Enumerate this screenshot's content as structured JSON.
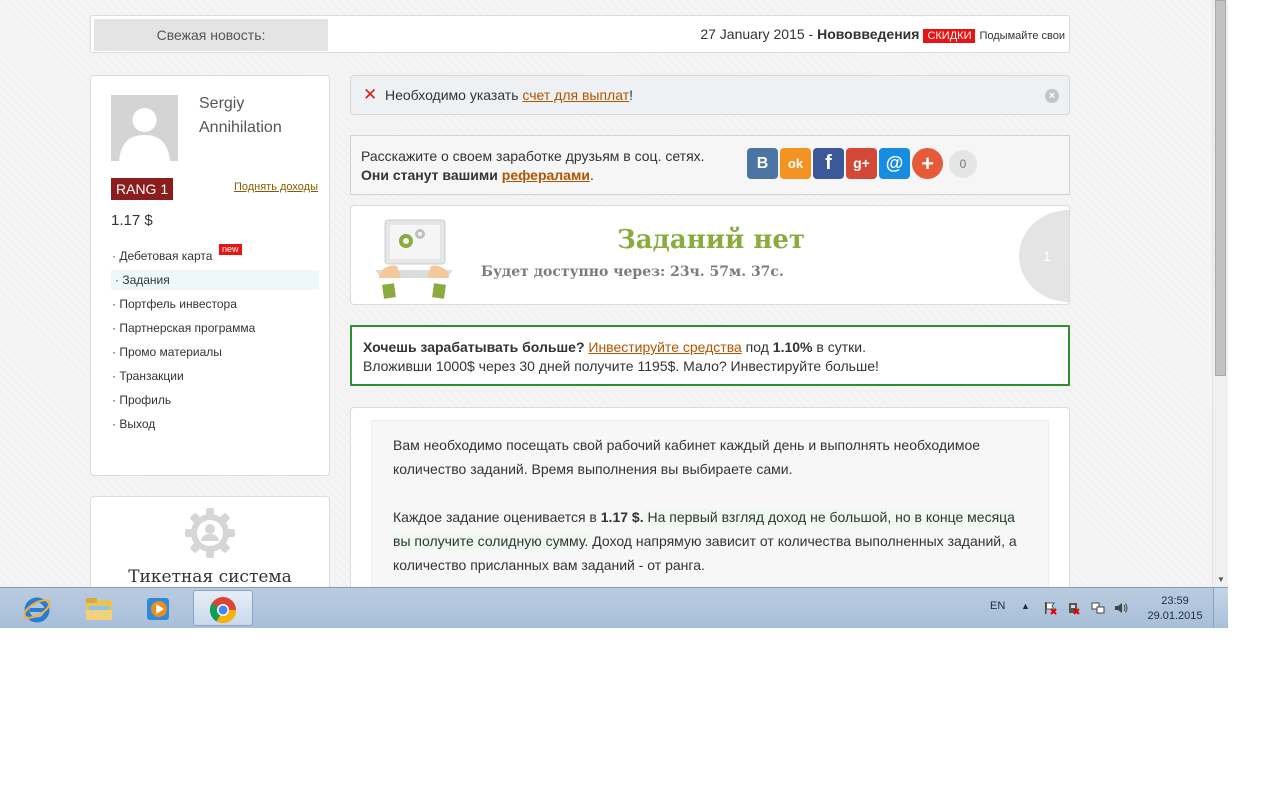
{
  "newsbar": {
    "label": "Свежая новость:",
    "date": "27 January 2015 - ",
    "title": "Нововведения",
    "badge": "СКИДКИ",
    "snippet": "Подымайте свои"
  },
  "sidebar": {
    "username_first": "Sergiy",
    "username_last": "Annihilation",
    "rank": "RANG 1",
    "raise_income": "Поднять доходы",
    "balance": "1.17 $",
    "menu": [
      {
        "label": "· Дебетовая карта",
        "badge": "new"
      },
      {
        "label": "· Задания"
      },
      {
        "label": "· Портфель инвестора"
      },
      {
        "label": "· Партнерская программа"
      },
      {
        "label": "· Промо материалы"
      },
      {
        "label": "· Транзакции"
      },
      {
        "label": "· Профиль"
      },
      {
        "label": "· Выход"
      }
    ],
    "tickets_title": "Тикетная система"
  },
  "alert": {
    "text_before": "Необходимо указать ",
    "link": "счет для выплат",
    "text_after": "!"
  },
  "share": {
    "line1": "Расскажите о своем заработке друзьям в соц. сетях.",
    "line2_before": "Они станут вашими ",
    "line2_link": "рефералами",
    "line2_after": ".",
    "buttons": [
      {
        "name": "vk",
        "glyph": "В",
        "color": "#4c75a3"
      },
      {
        "name": "odnoklassniki",
        "glyph": "ok",
        "color": "#f59322"
      },
      {
        "name": "facebook",
        "glyph": "f",
        "color": "#3b5998"
      },
      {
        "name": "google-plus",
        "glyph": "g+",
        "color": "#d34836"
      },
      {
        "name": "mail",
        "glyph": "@",
        "color": "#168de2"
      },
      {
        "name": "more",
        "glyph": "+",
        "color": "#e65a3a"
      }
    ],
    "count": "0"
  },
  "tasks": {
    "title": "Заданий нет",
    "subtitle": "Будет доступно через: 23ч. 57м. 37с.",
    "circle": "1"
  },
  "invest": {
    "q": "Хочешь зарабатывать больше?",
    "link": "Инвестируйте средства",
    "mid": " под ",
    "rate": "1.10%",
    "tail": " в сутки.",
    "line2": "Вложивши 1000$ через 30 дней получите 1195$. Мало? Инвестируйте больше!"
  },
  "info": {
    "p1": "Вам необходимо посещать свой рабочий кабинет каждый день и выполнять необходимое количество заданий. Время выполнения вы выбираете сами.",
    "p2_a": "Каждое задание оценивается в ",
    "p2_b": "1.17 $.",
    "p2_c": " На первый взгляд доход не большой, но в конце месяца вы получите солидную сумму.",
    "p2_d": " Доход напрямую зависит от количества выполненных заданий, а количество присланных вам заданий - от ранга."
  },
  "taskbar": {
    "apps": [
      {
        "name": "internet-explorer"
      },
      {
        "name": "file-explorer"
      },
      {
        "name": "media-player"
      },
      {
        "name": "chrome",
        "active": true
      }
    ],
    "lang": "EN",
    "time": "23:59",
    "date": "29.01.2015"
  }
}
